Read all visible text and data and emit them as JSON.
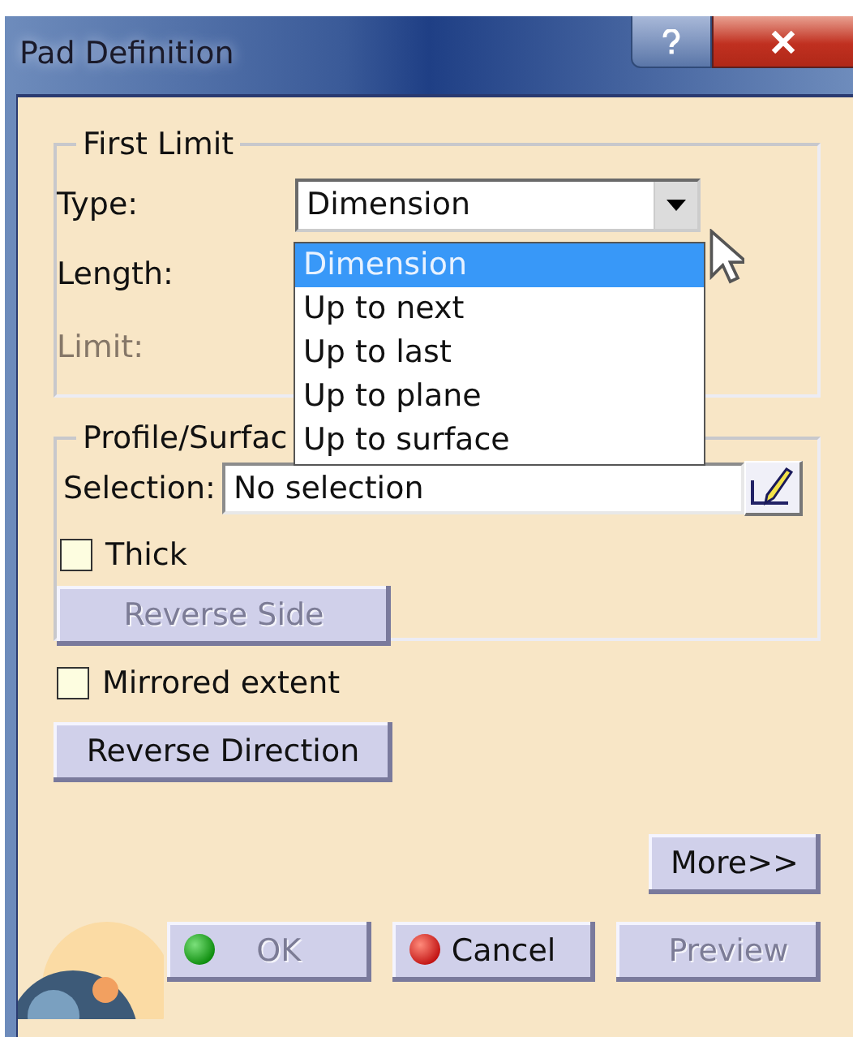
{
  "window": {
    "title": "Pad Definition"
  },
  "first_limit": {
    "title": "First Limit",
    "type": {
      "label": "Type:",
      "value": "Dimension",
      "expanded": true,
      "options": [
        {
          "label": "Dimension",
          "selected": true
        },
        {
          "label": "Up to next",
          "selected": false
        },
        {
          "label": "Up to last",
          "selected": false
        },
        {
          "label": "Up to plane",
          "selected": false
        },
        {
          "label": "Up to surface",
          "selected": false
        }
      ]
    },
    "length": {
      "label": "Length:"
    },
    "limit": {
      "label": "Limit:",
      "disabled": true
    }
  },
  "profile": {
    "title": "Profile/Surfac",
    "selection": {
      "label": "Selection:",
      "value": "No selection"
    },
    "thick": {
      "label": "Thick",
      "checked": false
    },
    "reverse_side": {
      "label": "Reverse Side",
      "disabled": true
    }
  },
  "mirrored": {
    "label": "Mirrored extent",
    "checked": false
  },
  "reverse_direction": {
    "label": "Reverse Direction",
    "disabled": false
  },
  "more": {
    "label": "More>>"
  },
  "buttons": [
    {
      "kind": "ok",
      "label": "OK",
      "disabled": true
    },
    {
      "kind": "cancel",
      "label": "Cancel",
      "disabled": false
    },
    {
      "kind": "preview",
      "label": "Preview",
      "disabled": true
    }
  ]
}
